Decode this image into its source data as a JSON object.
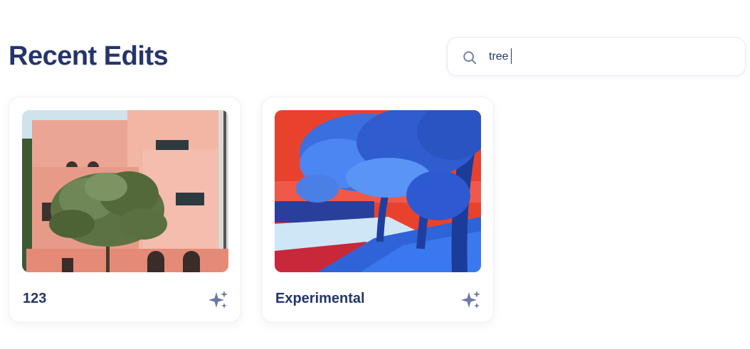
{
  "header": {
    "title": "Recent Edits"
  },
  "search": {
    "value": "tree",
    "icon": "search-icon"
  },
  "edits": [
    {
      "name": "123",
      "thumbnail": "pink-building-with-tree",
      "action_icon": "sparkle-icon"
    },
    {
      "name": "Experimental",
      "thumbnail": "blue-red-inverted-trees",
      "action_icon": "sparkle-icon"
    }
  ],
  "colors": {
    "title": "#25356b",
    "card_border": "#eef0f6",
    "icon": "#6b78a8"
  }
}
